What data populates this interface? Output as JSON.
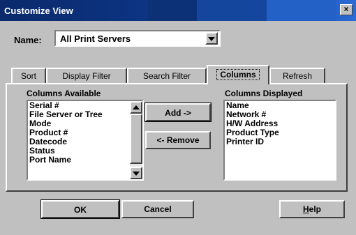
{
  "window": {
    "title": "Customize View",
    "close_glyph": "×"
  },
  "name_field": {
    "label": "Name:",
    "value": "All Print Servers"
  },
  "tabs": [
    {
      "label": "Sort",
      "active": false
    },
    {
      "label": "Display Filter",
      "active": false
    },
    {
      "label": "Search Filter",
      "active": false
    },
    {
      "label": "Columns",
      "active": true
    },
    {
      "label": "Refresh",
      "active": false
    }
  ],
  "columns_available": {
    "title": "Columns Available",
    "items": [
      "Serial #",
      "File Server or Tree",
      "Mode",
      "Product #",
      "Datecode",
      "Status",
      "Port Name"
    ]
  },
  "columns_displayed": {
    "title": "Columns Displayed",
    "items": [
      "Name",
      "Network #",
      "H/W Address",
      "Product Type",
      "Printer ID"
    ]
  },
  "buttons": {
    "add": "Add ->",
    "remove": "<- Remove",
    "ok": "OK",
    "cancel": "Cancel",
    "help_prefix": "",
    "help_accel": "H",
    "help_rest": "elp"
  }
}
